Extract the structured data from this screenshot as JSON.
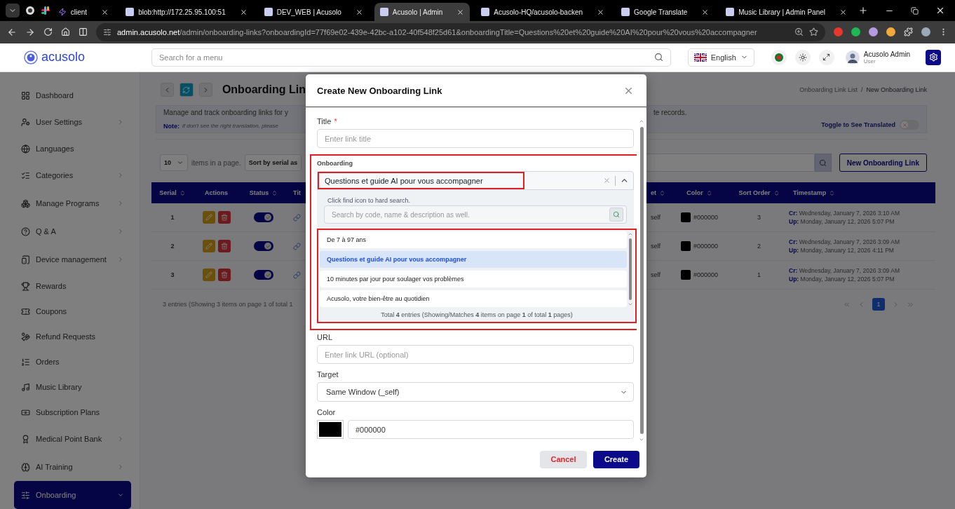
{
  "browser": {
    "tabs": [
      {
        "title": "client",
        "selected": false
      },
      {
        "title": "blob:http://172.25.95.100:51",
        "selected": false
      },
      {
        "title": "DEV_WEB | Acusolo",
        "selected": false
      },
      {
        "title": "Acusolo | Admin",
        "selected": true
      },
      {
        "title": "Acusolo-HQ/acusolo-backen",
        "selected": false
      },
      {
        "title": "Google Translate",
        "selected": false
      },
      {
        "title": "Music Library | Admin Panel",
        "selected": false
      }
    ],
    "address": {
      "domain": "admin.acusolo.net",
      "path": "/admin/onboarding-links?onboardingId=77f69e02-439e-42bc-a102-40f548f25d61&onboardingTitle=Questions%20et%20guide%20AI%20pour%20vous%20accompagner"
    }
  },
  "header": {
    "logo": "acusolo",
    "search_placeholder": "Search for a menu",
    "language": "English",
    "user_name": "Acusolo Admin",
    "user_role": "User"
  },
  "sidebar": {
    "items": [
      {
        "label": "Dashboard",
        "expandable": false,
        "expanded": false,
        "selected": false
      },
      {
        "label": "User Settings",
        "expandable": true,
        "expanded": false,
        "selected": false
      },
      {
        "label": "Languages",
        "expandable": false,
        "expanded": false,
        "selected": false
      },
      {
        "label": "Categories",
        "expandable": true,
        "expanded": false,
        "selected": false
      },
      {
        "label": "Manage Programs",
        "expandable": true,
        "expanded": false,
        "selected": false
      },
      {
        "label": "Q & A",
        "expandable": true,
        "expanded": false,
        "selected": false
      },
      {
        "label": "Device management",
        "expandable": true,
        "expanded": false,
        "selected": false
      },
      {
        "label": "Rewards",
        "expandable": false,
        "expanded": false,
        "selected": false
      },
      {
        "label": "Coupons",
        "expandable": false,
        "expanded": false,
        "selected": false
      },
      {
        "label": "Refund Requests",
        "expandable": false,
        "expanded": false,
        "selected": false
      },
      {
        "label": "Orders",
        "expandable": false,
        "expanded": false,
        "selected": false
      },
      {
        "label": "Music Library",
        "expandable": false,
        "expanded": false,
        "selected": false
      },
      {
        "label": "Subscription Plans",
        "expandable": false,
        "expanded": false,
        "selected": false
      },
      {
        "label": "Medical Point Bank",
        "expandable": true,
        "expanded": false,
        "selected": false
      },
      {
        "label": "AI Training",
        "expandable": true,
        "expanded": false,
        "selected": false
      },
      {
        "label": "Onboarding",
        "expandable": true,
        "expanded": true,
        "selected": true
      }
    ]
  },
  "page": {
    "title": "Onboarding Lin",
    "breadcrumbs": [
      "Onboarding Link List",
      "New Onboarding Link"
    ],
    "breadcrumb_separator": "/",
    "description": "Manage and track onboarding links for y",
    "description_end": "te records.",
    "note_label": "Note:",
    "note": "if don't see the right translation, please",
    "translate_toggle": {
      "label": "Toggle to See Translated",
      "on": false
    },
    "page_size": "10",
    "page_size_label": "items in a page.",
    "sort": "Sort by serial as",
    "new_button": "New Onboarding Link"
  },
  "table": {
    "columns_left": [
      {
        "label": "Serial",
        "sortable": true
      },
      {
        "label": "Actions",
        "sortable": false
      },
      {
        "label": "Status",
        "sortable": true
      },
      {
        "label": "Tit",
        "sortable": false
      }
    ],
    "columns_right": [
      {
        "label": "et",
        "sortable": true
      },
      {
        "label": "Color",
        "sortable": true
      },
      {
        "label": "Sort Order",
        "sortable": true
      },
      {
        "label": "Timestamp",
        "sortable": true
      }
    ],
    "rows": [
      {
        "serial": "1",
        "status_on": true,
        "target": "self",
        "color": "#000000",
        "color_text": "#000000",
        "sort_order": "3",
        "created_label": "Cr:",
        "created": "Wednesday, January 7, 2026 3:10 AM",
        "updated_label": "Up:",
        "updated": "Monday, January 12, 2026 5:07 PM"
      },
      {
        "serial": "2",
        "status_on": true,
        "target": "self",
        "color": "#000000",
        "color_text": "#000000",
        "sort_order": "2",
        "created_label": "Cr:",
        "created": "Wednesday, January 7, 2026 3:09 AM",
        "updated_label": "Up:",
        "updated": "Monday, January 12, 2026 4:11 PM"
      },
      {
        "serial": "3",
        "status_on": true,
        "target": "self",
        "color": "#000000",
        "color_text": "#000000",
        "sort_order": "1",
        "created_label": "Cr:",
        "created": "Wednesday, January 7, 2026 3:09 AM",
        "updated_label": "Up:",
        "updated": "Monday, January 12, 2026 5:07 PM"
      }
    ],
    "entries": "3 entries (Showing 3 items on page 1 of total 1",
    "pages": [
      {
        "label": "1",
        "selected": true
      }
    ]
  },
  "modal": {
    "title": "Create New Onboarding Link",
    "title_field": {
      "label": "Title",
      "required_mark": "*",
      "placeholder": "Enter link title"
    },
    "onboarding": {
      "label": "Onboarding",
      "value": "Questions et guide AI pour vous accompagner",
      "open": true,
      "highlighted": true,
      "value_highlighted": true,
      "list_highlighted": true,
      "hint": "Click find icon to hard search.",
      "search_placeholder": "Search by code, name & description as well.",
      "options": [
        {
          "label": "De 7 à 97 ans",
          "selected": false
        },
        {
          "label": "Questions et guide AI pour vous accompagner",
          "selected": true
        },
        {
          "label": "10 minutes par jour pour soulager vos problèmes",
          "selected": false
        },
        {
          "label": "Acusolo, votre bien-être au quotidien",
          "selected": false
        }
      ],
      "footer": "Total  **4**  entries (Showing/Matches  **4**  items on page  **1**  of total  **1**  pages)"
    },
    "url_field": {
      "label": "URL",
      "placeholder": "Enter link URL (optional)"
    },
    "target_field": {
      "label": "Target",
      "value": "Same Window (_self)"
    },
    "color_field": {
      "label": "Color",
      "color": "#000000",
      "value": "#000000"
    },
    "cancel": "Cancel",
    "create": "Create"
  }
}
